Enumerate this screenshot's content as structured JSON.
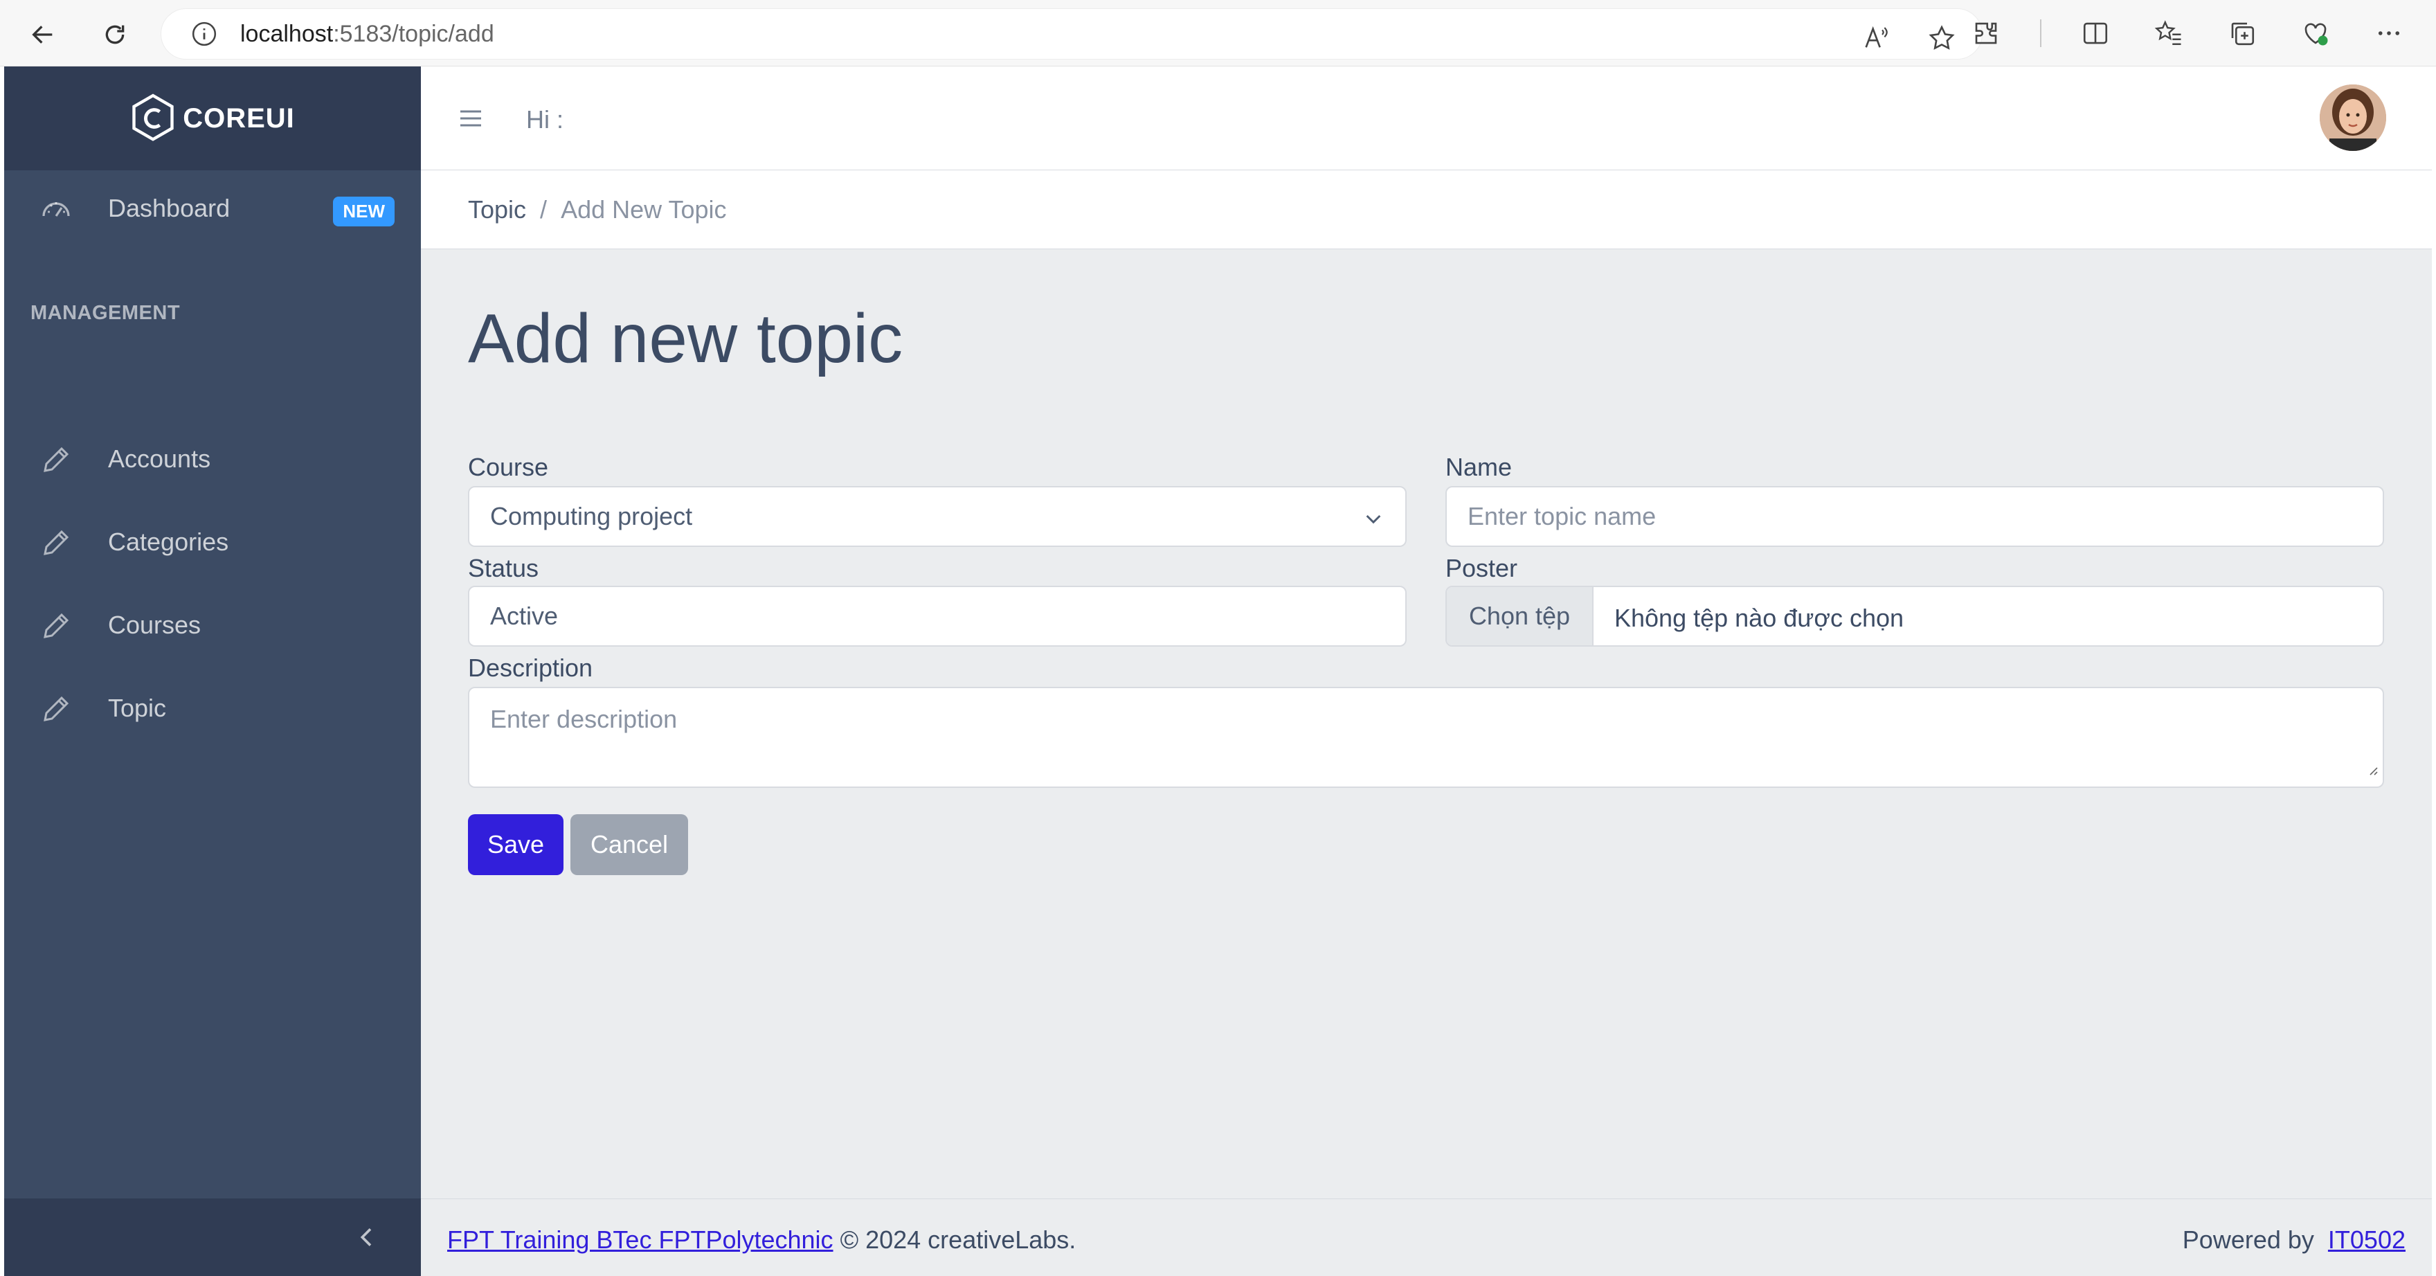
{
  "browser": {
    "url_host": "localhost",
    "url_path": ":5183/topic/add"
  },
  "sidebar": {
    "brand": "COREUI",
    "items": [
      {
        "label": "Dashboard",
        "badge": "NEW"
      },
      {
        "label": "Accounts"
      },
      {
        "label": "Categories"
      },
      {
        "label": "Courses"
      },
      {
        "label": "Topic"
      }
    ],
    "section_title": "MANAGEMENT"
  },
  "header": {
    "greeting": "Hi :"
  },
  "breadcrumb": {
    "parent": "Topic",
    "separator": "/",
    "current": "Add New Topic"
  },
  "form": {
    "title": "Add new topic",
    "course_label": "Course",
    "course_value": "Computing project",
    "name_label": "Name",
    "name_placeholder": "Enter topic name",
    "status_label": "Status",
    "status_value": "Active",
    "poster_label": "Poster",
    "poster_button": "Chọn tệp",
    "poster_status": "Không tệp nào được chọn",
    "description_label": "Description",
    "description_placeholder": "Enter description",
    "save_label": "Save",
    "cancel_label": "Cancel"
  },
  "footer": {
    "org_link": "FPT Training BTec FPTPolytechnic",
    "copyright": "© 2024 creativeLabs.",
    "powered_by": "Powered by",
    "powered_link": "IT0502"
  },
  "colors": {
    "sidebar": "#3c4b64",
    "primary": "#321fdb",
    "secondary": "#9da5b1",
    "badge": "#3399ff"
  }
}
